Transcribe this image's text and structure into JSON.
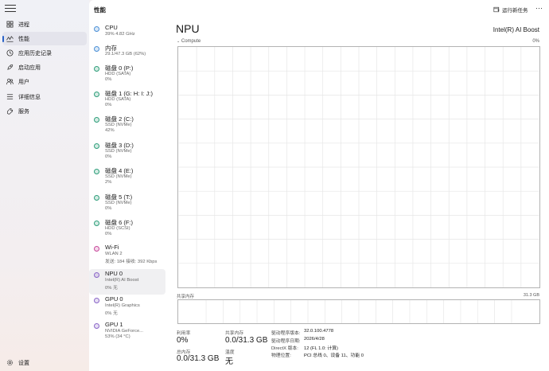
{
  "nav": {
    "items": [
      {
        "label": "进程",
        "icon": "processes-icon"
      },
      {
        "label": "性能",
        "icon": "performance-icon"
      },
      {
        "label": "应用历史记录",
        "icon": "app-history-icon"
      },
      {
        "label": "启动应用",
        "icon": "startup-apps-icon"
      },
      {
        "label": "用户",
        "icon": "users-icon"
      },
      {
        "label": "详细信息",
        "icon": "details-icon"
      },
      {
        "label": "服务",
        "icon": "services-icon"
      }
    ],
    "settings_label": "设置",
    "active_index": 1
  },
  "header": {
    "title": "性能",
    "run_task_label": "运行新任务",
    "more_label": "···"
  },
  "devices": [
    {
      "name": "CPU",
      "sub1": "39% 4.82 GHz",
      "sub2": "",
      "color": "#4a8fd6"
    },
    {
      "name": "内存",
      "sub1": "29.1/47.3 GB (62%)",
      "sub2": "",
      "color": "#4a8fd6"
    },
    {
      "name": "磁盘 0 (P:)",
      "sub1": "HDD (SATA)",
      "sub2": "0%",
      "color": "#2e9e7a"
    },
    {
      "name": "磁盘 1 (G: H: I: J:)",
      "sub1": "HDD (SATA)",
      "sub2": "0%",
      "color": "#2e9e7a"
    },
    {
      "name": "磁盘 2 (C:)",
      "sub1": "SSD (NVMe)",
      "sub2": "42%",
      "color": "#2e9e7a"
    },
    {
      "name": "磁盘 3 (D:)",
      "sub1": "SSD (NVMe)",
      "sub2": "0%",
      "color": "#2e9e7a"
    },
    {
      "name": "磁盘 4 (E:)",
      "sub1": "SSD (NVMe)",
      "sub2": "2%",
      "color": "#2e9e7a"
    },
    {
      "name": "磁盘 5 (T:)",
      "sub1": "SSD (NVMe)",
      "sub2": "0%",
      "color": "#2e9e7a"
    },
    {
      "name": "磁盘 6 (F:)",
      "sub1": "HDD (SCSI)",
      "sub2": "0%",
      "color": "#2e9e7a"
    },
    {
      "name": "Wi-Fi",
      "sub1": "WLAN 2",
      "sub2": "发送: 184 接收: 392 Kbps",
      "color": "#c8489b"
    },
    {
      "name": "NPU 0",
      "sub1": "Intel(R) AI Boost",
      "sub2": "0% 无",
      "color": "#8a66c8"
    },
    {
      "name": "GPU 0",
      "sub1": "Intel(R) Graphics",
      "sub2": "0% 无",
      "color": "#8a66c8"
    },
    {
      "name": "GPU 1",
      "sub1": "NVIDIA GeForce...",
      "sub2": "53% (34 °C)",
      "color": "#8a66c8"
    }
  ],
  "detail": {
    "title": "NPU",
    "model": "Intel(R) AI Boost",
    "graph_label": "Compute",
    "graph_max": "0%",
    "mem_label": "共享内存",
    "mem_max": "31.3 GB",
    "stats": {
      "util_label": "利用率",
      "util_value": "0%",
      "shared_mem_label": "共享内存",
      "shared_mem_value": "0.0/31.3 GB",
      "total_mem_label": "总内存",
      "total_mem_value": "0.0/31.3 GB",
      "temp_label": "温度",
      "temp_value": "无"
    },
    "info": [
      {
        "key": "驱动程序版本:",
        "value": "32.0.100.4778"
      },
      {
        "key": "驱动程序日期:",
        "value": "2026/4/28"
      },
      {
        "key": "DirectX 版本:",
        "value": "12 (FL 1.0: 计算)"
      },
      {
        "key": "物理位置:",
        "value": "PCI 总线 0、设备 11、功能 0"
      }
    ]
  },
  "colors": {
    "accent": "#2a62c8",
    "graph_border": "#b3b3b3",
    "grid": "#e6e6e6"
  }
}
